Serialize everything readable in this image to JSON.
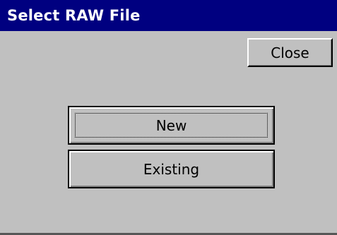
{
  "window": {
    "title": "Select RAW File"
  },
  "buttons": {
    "close_label": "Close",
    "new_label": "New",
    "existing_label": "Existing"
  },
  "colors": {
    "titlebar": "#000080",
    "title_text": "#ffffff",
    "face": "#c0c0c0"
  }
}
